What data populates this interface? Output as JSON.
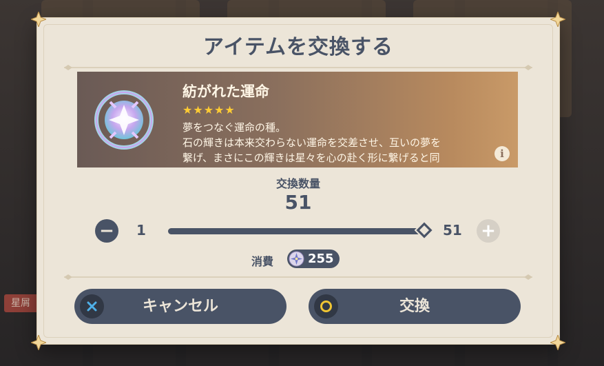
{
  "background": {
    "tag": "星屑"
  },
  "dialog": {
    "title": "アイテムを交換する",
    "item": {
      "name": "紡がれた運命",
      "stars": "★★★★★",
      "rarity": 5,
      "description_lines": [
        "夢をつなぐ運命の種。",
        "石の輝きは本来交わらない運命を交差させ、互いの夢を",
        "繋げ、まさにこの輝きは星々を心の赴く形に繋げると同"
      ],
      "info_icon": "i"
    },
    "quantity": {
      "label": "交換数量",
      "value": "51",
      "min": "1",
      "max": "51",
      "fraction": 1.0
    },
    "cost": {
      "label": "消費",
      "amount": "255",
      "currency_icon": "starglitter-icon"
    },
    "buttons": {
      "cancel": "キャンセル",
      "confirm": "交換"
    }
  },
  "colors": {
    "panel": "#ece5d8",
    "text_dark": "#495366",
    "accent_star": "#ffcc33",
    "confirm_ring": "#f0c533",
    "cancel_x": "#4fb0e8"
  }
}
